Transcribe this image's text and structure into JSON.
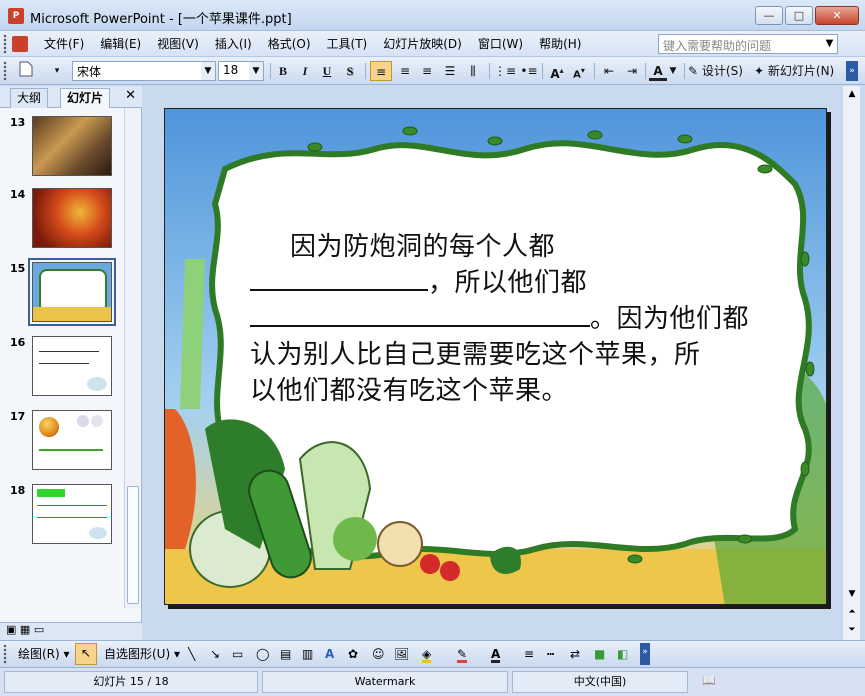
{
  "window": {
    "title": "Microsoft PowerPoint - [一个苹果课件.ppt]",
    "controls": {
      "minimize": "—",
      "maximize": "□",
      "close": "✕"
    }
  },
  "menubar": {
    "items": [
      "文件(F)",
      "编辑(E)",
      "视图(V)",
      "插入(I)",
      "格式(O)",
      "工具(T)",
      "幻灯片放映(D)",
      "窗口(W)",
      "帮助(H)"
    ],
    "help_placeholder": "键入需要帮助的问题"
  },
  "toolbar": {
    "font_name": "宋体",
    "font_size": "18",
    "bold": "B",
    "italic": "I",
    "underline": "U",
    "shadow": "S",
    "design_label": "设计(S)",
    "new_slide_label": "新幻灯片(N)"
  },
  "leftpane": {
    "tabs": [
      "大纲",
      "幻灯片"
    ],
    "active_tab": "幻灯片",
    "thumbnails": [
      {
        "number": "13"
      },
      {
        "number": "14"
      },
      {
        "number": "15",
        "selected": true
      },
      {
        "number": "16"
      },
      {
        "number": "17"
      },
      {
        "number": "18"
      }
    ]
  },
  "slide": {
    "lines": [
      "因为防炮洞的每个人都",
      "，所以他们都",
      "。因为他们都",
      "认为别人比自己更需要吃这个苹果，所",
      "以他们都没有吃这个苹果。"
    ]
  },
  "drawbar": {
    "draw_label": "绘图(R)",
    "autoshapes_label": "自选图形(U)"
  },
  "statusbar": {
    "slide_position": "幻灯片 15 / 18",
    "design": "Watermark",
    "language": "中文(中国)"
  }
}
